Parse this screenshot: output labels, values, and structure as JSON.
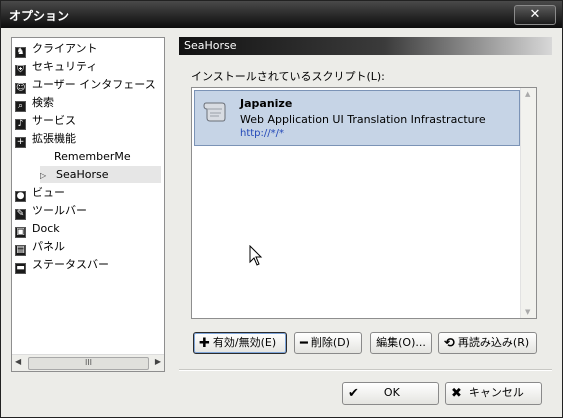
{
  "window": {
    "title": "オプション",
    "close_glyph": "✕"
  },
  "sidebar": {
    "items": [
      {
        "label": "クライアント",
        "icon": "client-icon",
        "glyph": "♞"
      },
      {
        "label": "セキュリティ",
        "icon": "shield-icon",
        "glyph": "⛨"
      },
      {
        "label": "ユーザー インタフェース",
        "icon": "user-interface-icon",
        "glyph": "☺"
      },
      {
        "label": "検索",
        "icon": "search-icon",
        "glyph": "⌕"
      },
      {
        "label": "サービス",
        "icon": "bell-icon",
        "glyph": "♪"
      },
      {
        "label": "拡張機能",
        "icon": "plus-icon",
        "glyph": "+"
      },
      {
        "label": "RememberMe"
      },
      {
        "label": "SeaHorse"
      },
      {
        "label": "ビュー",
        "icon": "view-icon",
        "glyph": "●"
      },
      {
        "label": "ツールバー",
        "icon": "pencil-icon",
        "glyph": "✎"
      },
      {
        "label": "Dock",
        "icon": "dock-icon",
        "glyph": "▣"
      },
      {
        "label": "パネル",
        "icon": "panel-icon",
        "glyph": "▤"
      },
      {
        "label": "ステータスバー",
        "icon": "statusbar-icon",
        "glyph": "▬"
      }
    ],
    "expander_glyph": "▷",
    "scroll_grip": "III"
  },
  "panel": {
    "header": "SeaHorse",
    "scripts_label": "インストールされているスクリプト(L):",
    "scripts": [
      {
        "name": "Japanize",
        "description": "Web Application UI Translation Infrastracture",
        "url": "http://*/*",
        "icon": "scroll-icon"
      }
    ]
  },
  "actions": {
    "toggle": "有効/無効(E)",
    "delete": "削除(D)",
    "edit": "編集(O)...",
    "reload": "再読み込み(R)"
  },
  "dialog": {
    "ok": "OK",
    "cancel": "キャンセル"
  },
  "colors": {
    "selection": "#c6d4e6",
    "link": "#2348b8"
  }
}
